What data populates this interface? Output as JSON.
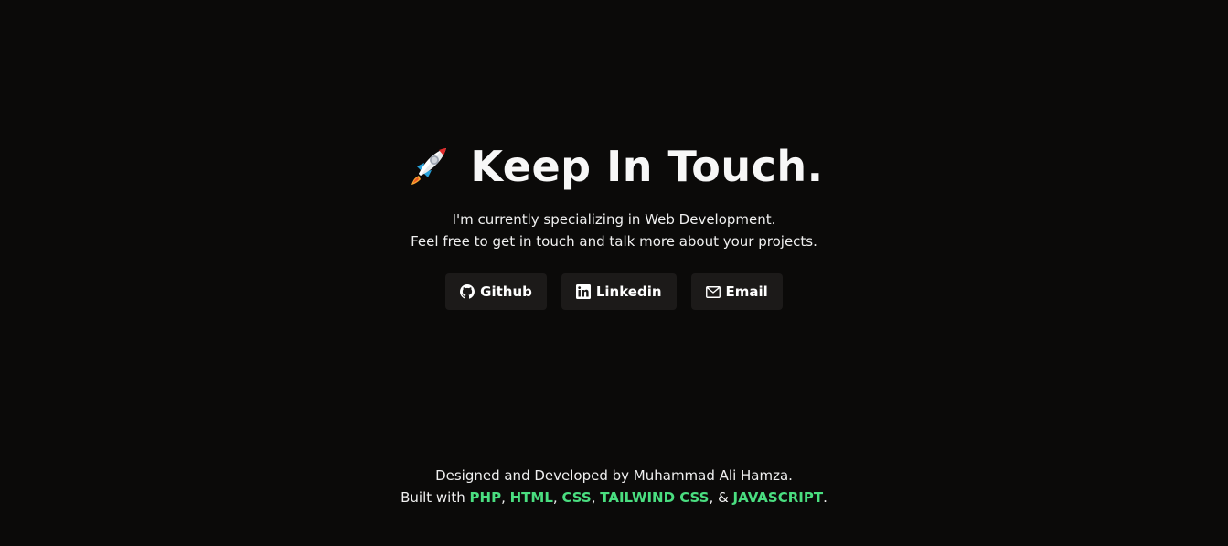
{
  "hero": {
    "rocket_icon": "rocket-emoji-icon",
    "title": "Keep In Touch.",
    "line1": "I'm currently specializing in Web Development.",
    "line2": "Feel free to get in touch and talk more about your projects."
  },
  "buttons": [
    {
      "label": "Github",
      "icon": "github-icon"
    },
    {
      "label": "Linkedin",
      "icon": "linkedin-icon"
    },
    {
      "label": "Email",
      "icon": "mail-icon"
    }
  ],
  "footer": {
    "credit": "Designed and Developed by Muhammad Ali Hamza.",
    "built_with_prefix": "Built with",
    "techs": [
      "PHP",
      "HTML",
      "CSS",
      "TAILWIND CSS",
      "JAVASCRIPT"
    ],
    "separator": ",",
    "and": "&",
    "end": "."
  },
  "colors": {
    "background": "#0b0a09",
    "button_bg": "#1c1a19",
    "accent_green": "#4ade80",
    "text": "#f5f5f5"
  }
}
